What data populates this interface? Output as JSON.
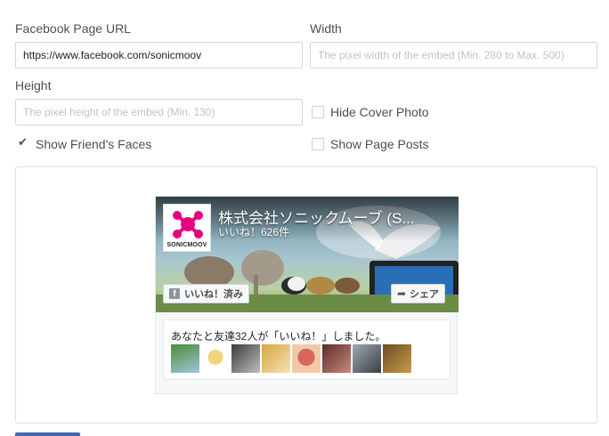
{
  "fields": {
    "url_label": "Facebook Page URL",
    "url_value": "https://www.facebook.com/sonicmoov",
    "width_label": "Width",
    "width_placeholder": "The pixel width of the embed (Min. 280 to Max. 500)",
    "height_label": "Height",
    "height_placeholder": "The pixel height of the embed (Min. 130)"
  },
  "options": {
    "hide_cover": {
      "label": "Hide Cover Photo",
      "checked": false
    },
    "show_faces": {
      "label": "Show Friend's Faces",
      "checked": true
    },
    "show_posts": {
      "label": "Show Page Posts",
      "checked": false
    }
  },
  "preview": {
    "page_name": "株式会社ソニックムーブ (S...",
    "likes": "いいね！626件",
    "logo_text": "SONICMOOV",
    "like_button": "いいね！済み",
    "share_button": "シェア",
    "friends_text": "あなたと友達32人が「いいね！」しました。",
    "fb_glyph": "f",
    "share_glyph": "➦"
  },
  "colors": {
    "accent": "#4267b2",
    "logo_pink": "#e5007e"
  }
}
